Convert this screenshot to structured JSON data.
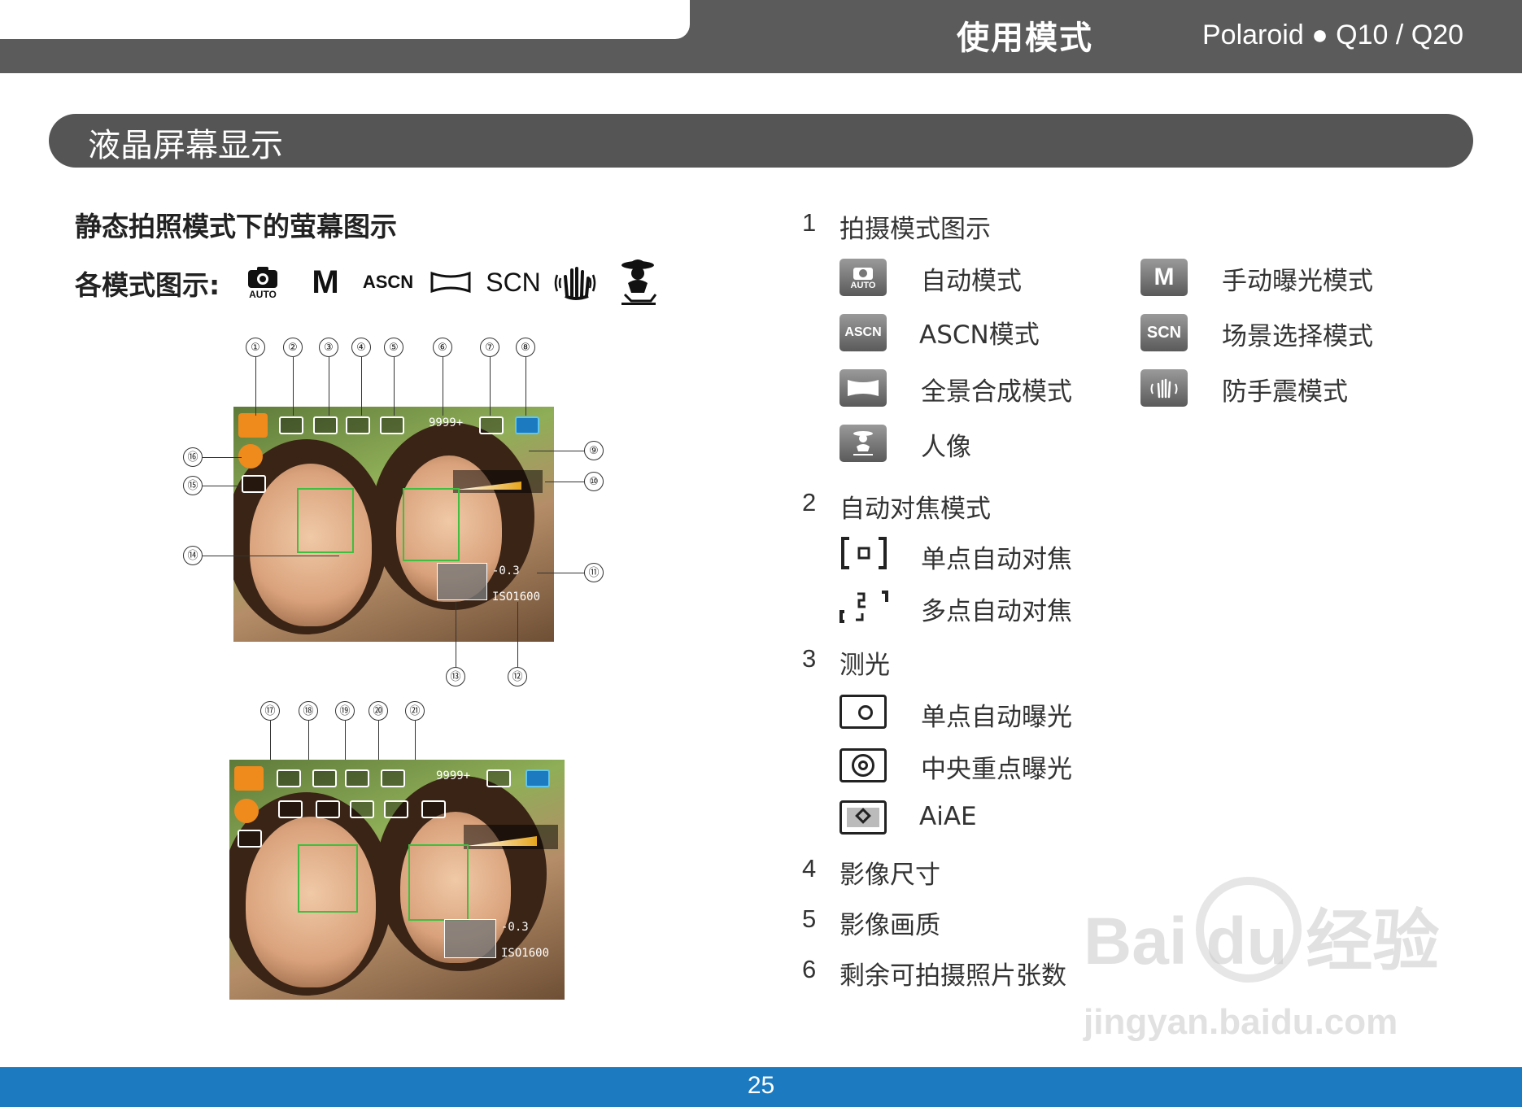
{
  "header": {
    "title": "使用模式",
    "brand": "Polaroid  ●  Q10 / Q20"
  },
  "section": {
    "title": "液晶屏幕显示"
  },
  "subtitle": "静态拍照模式下的萤幕图示",
  "modes": {
    "label": "各模式图示:",
    "icons": [
      {
        "name": "auto-camera-icon",
        "text": "AUTO"
      },
      {
        "name": "manual-icon",
        "text": "M"
      },
      {
        "name": "ascn-icon",
        "text": "ASCN"
      },
      {
        "name": "panorama-icon",
        "text": ""
      },
      {
        "name": "scn-icon",
        "text": "SCN"
      },
      {
        "name": "anti-shake-icon",
        "text": ""
      },
      {
        "name": "portrait-icon",
        "text": ""
      }
    ]
  },
  "screen1": {
    "callouts_top": [
      "①",
      "②",
      "③",
      "④",
      "⑤",
      "⑥",
      "⑦",
      "⑧"
    ],
    "callouts_right": [
      "⑨",
      "⑩",
      "⑪"
    ],
    "callouts_left": [
      "⑯",
      "⑮",
      "⑭"
    ],
    "callouts_bottom": [
      "⑬",
      "⑫"
    ],
    "shots": "9999+",
    "ev": "-0.3",
    "iso": "ISO1600"
  },
  "screen2": {
    "callouts_top": [
      "⑰",
      "⑱",
      "⑲",
      "⑳",
      "㉑"
    ],
    "shots": "9999+",
    "ev": "-0.3",
    "iso": "ISO1600"
  },
  "list": {
    "s1": {
      "num": "1",
      "title": "拍摄模式图示"
    },
    "s1_items": [
      {
        "icon": "AUTO",
        "label": "自动模式"
      },
      {
        "icon": "M",
        "label": "手动曝光模式"
      },
      {
        "icon": "ASCN",
        "label": "ASCN模式"
      },
      {
        "icon": "SCN",
        "label": "场景选择模式"
      },
      {
        "icon": "",
        "label": "全景合成模式"
      },
      {
        "icon": "",
        "label": "防手震模式"
      },
      {
        "icon": "",
        "label": "人像"
      }
    ],
    "s2": {
      "num": "2",
      "title": "自动对焦模式"
    },
    "s2_items": [
      "单点自动对焦",
      "多点自动对焦"
    ],
    "s3": {
      "num": "3",
      "title": "测光"
    },
    "s3_items": [
      "单点自动曝光",
      "中央重点曝光",
      "AiAE"
    ],
    "s4": {
      "num": "4",
      "title": "影像尺寸"
    },
    "s5": {
      "num": "5",
      "title": "影像画质"
    },
    "s6": {
      "num": "6",
      "title": "剩余可拍摄照片张数"
    }
  },
  "footer": {
    "page": "25"
  },
  "watermark": {
    "line1": "Bai du 经验",
    "line2": "jingyan.baidu.com"
  },
  "colors": {
    "header": "#5b5b5b",
    "footer": "#1b7ac0",
    "osd_orange": "#ef8a1d",
    "af_green": "#3fbf3f"
  }
}
